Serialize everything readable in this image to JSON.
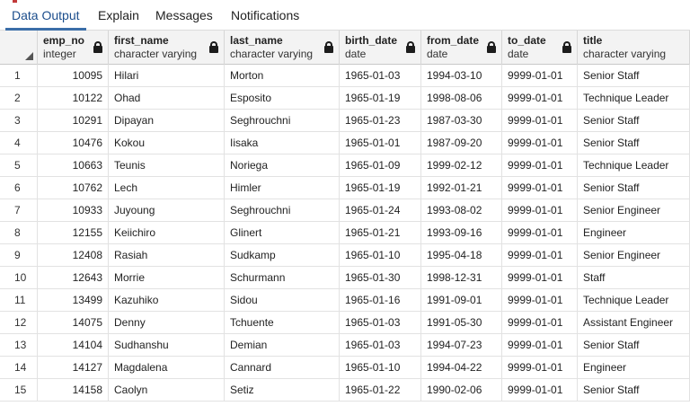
{
  "tabs": [
    "Data Output",
    "Explain",
    "Messages",
    "Notifications"
  ],
  "active_tab": 0,
  "columns": [
    {
      "name": "emp_no",
      "type": "integer",
      "locked": true
    },
    {
      "name": "first_name",
      "type": "character varying",
      "locked": true
    },
    {
      "name": "last_name",
      "type": "character varying",
      "locked": true
    },
    {
      "name": "birth_date",
      "type": "date",
      "locked": true
    },
    {
      "name": "from_date",
      "type": "date",
      "locked": true
    },
    {
      "name": "to_date",
      "type": "date",
      "locked": true
    },
    {
      "name": "title",
      "type": "character varying",
      "locked": false
    }
  ],
  "rows": [
    [
      "1",
      "10095",
      "Hilari",
      "Morton",
      "1965-01-03",
      "1994-03-10",
      "9999-01-01",
      "Senior Staff"
    ],
    [
      "2",
      "10122",
      "Ohad",
      "Esposito",
      "1965-01-19",
      "1998-08-06",
      "9999-01-01",
      "Technique Leader"
    ],
    [
      "3",
      "10291",
      "Dipayan",
      "Seghrouchni",
      "1965-01-23",
      "1987-03-30",
      "9999-01-01",
      "Senior Staff"
    ],
    [
      "4",
      "10476",
      "Kokou",
      "Iisaka",
      "1965-01-01",
      "1987-09-20",
      "9999-01-01",
      "Senior Staff"
    ],
    [
      "5",
      "10663",
      "Teunis",
      "Noriega",
      "1965-01-09",
      "1999-02-12",
      "9999-01-01",
      "Technique Leader"
    ],
    [
      "6",
      "10762",
      "Lech",
      "Himler",
      "1965-01-19",
      "1992-01-21",
      "9999-01-01",
      "Senior Staff"
    ],
    [
      "7",
      "10933",
      "Juyoung",
      "Seghrouchni",
      "1965-01-24",
      "1993-08-02",
      "9999-01-01",
      "Senior Engineer"
    ],
    [
      "8",
      "12155",
      "Keiichiro",
      "Glinert",
      "1965-01-21",
      "1993-09-16",
      "9999-01-01",
      "Engineer"
    ],
    [
      "9",
      "12408",
      "Rasiah",
      "Sudkamp",
      "1965-01-10",
      "1995-04-18",
      "9999-01-01",
      "Senior Engineer"
    ],
    [
      "10",
      "12643",
      "Morrie",
      "Schurmann",
      "1965-01-30",
      "1998-12-31",
      "9999-01-01",
      "Staff"
    ],
    [
      "11",
      "13499",
      "Kazuhiko",
      "Sidou",
      "1965-01-16",
      "1991-09-01",
      "9999-01-01",
      "Technique Leader"
    ],
    [
      "12",
      "14075",
      "Denny",
      "Tchuente",
      "1965-01-03",
      "1991-05-30",
      "9999-01-01",
      "Assistant Engineer"
    ],
    [
      "13",
      "14104",
      "Sudhanshu",
      "Demian",
      "1965-01-03",
      "1994-07-23",
      "9999-01-01",
      "Senior Staff"
    ],
    [
      "14",
      "14127",
      "Magdalena",
      "Cannard",
      "1965-01-10",
      "1994-04-22",
      "9999-01-01",
      "Engineer"
    ],
    [
      "15",
      "14158",
      "Caolyn",
      "Setiz",
      "1965-01-22",
      "1990-02-06",
      "9999-01-01",
      "Senior Staff"
    ]
  ]
}
